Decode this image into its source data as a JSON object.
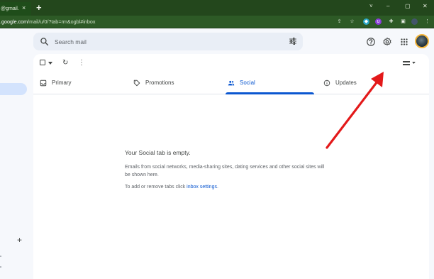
{
  "browser": {
    "tab_title": "@gmail.",
    "tab_close": "×",
    "new_tab": "+",
    "url_host": ".google.com",
    "url_path": "/mail/u/0/?tab=rm&ogbl#inbox",
    "window_controls": [
      "˅",
      "–",
      "▢",
      "✕"
    ]
  },
  "search": {
    "placeholder": "Search mail"
  },
  "toolbar": {
    "more": "⋮",
    "refresh": "↻"
  },
  "tabs": [
    {
      "label": "Primary",
      "icon": "inbox-icon"
    },
    {
      "label": "Promotions",
      "icon": "tag-icon"
    },
    {
      "label": "Social",
      "icon": "people-icon",
      "active": true
    },
    {
      "label": "Updates",
      "icon": "info-icon"
    }
  ],
  "empty_state": {
    "title": "Your Social tab is empty.",
    "description": "Emails from social networks, media-sharing sites, dating services and other social sites will be shown here.",
    "settings_prefix": "To add or remove tabs click ",
    "settings_link": "inbox settings",
    "settings_suffix": "."
  },
  "sidebar": {
    "add_label": "+"
  },
  "colors": {
    "accent": "#0b57d0",
    "arrow": "#e3191a",
    "chrome_dark": "#23471c"
  }
}
